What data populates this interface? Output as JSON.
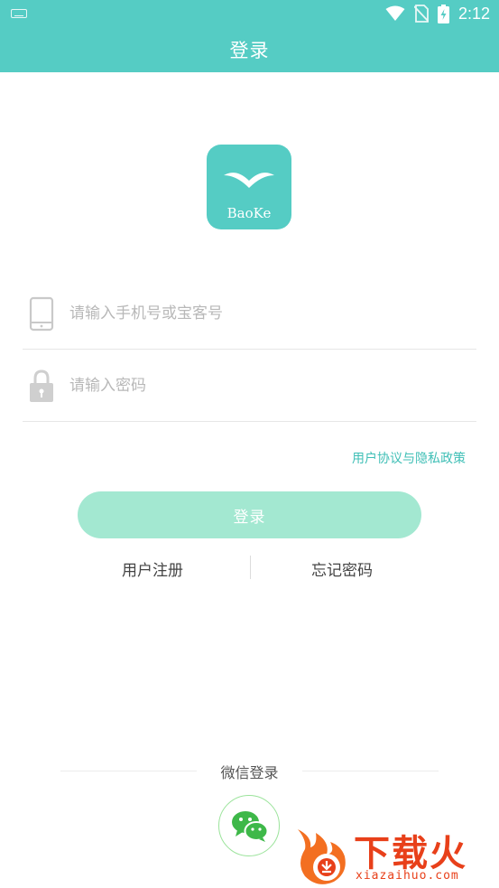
{
  "status_bar": {
    "time": "2:12"
  },
  "header": {
    "title": "登录"
  },
  "logo": {
    "text": "BaoKe"
  },
  "form": {
    "phone_placeholder": "请输入手机号或宝客号",
    "password_placeholder": "请输入密码"
  },
  "agreement_link": "用户协议与隐私政策",
  "login_button": "登录",
  "links": {
    "register": "用户注册",
    "forgot": "忘记密码"
  },
  "wechat": {
    "label": "微信登录"
  },
  "watermark": {
    "title": "下载火",
    "subtitle": "xiazaihuo.com"
  },
  "colors": {
    "primary": "#55ccc4",
    "button": "#a3e8d1",
    "link": "#3fbfb6",
    "wechat": "#3eb849",
    "watermark": "#e8401a"
  }
}
